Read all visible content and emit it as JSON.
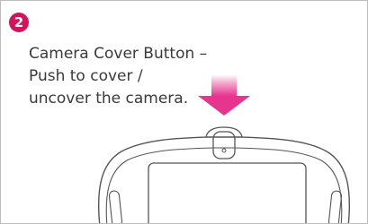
{
  "step": {
    "number": "2",
    "caption_lines": [
      "Camera Cover Button –",
      "Push to cover /",
      "uncover the camera."
    ]
  },
  "colors": {
    "badge": "#d4145a",
    "arrow": "#e7358f",
    "arrow_fade": "#ffffff",
    "device_outline": "#555555",
    "frame_border": "#bdbdbd",
    "text": "#3a3a3a"
  }
}
